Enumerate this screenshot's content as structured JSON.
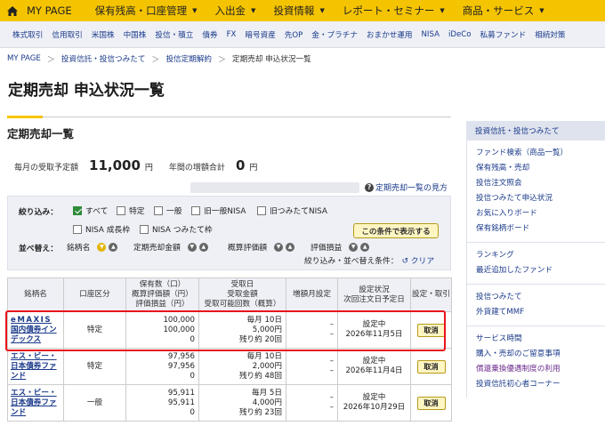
{
  "topnav": {
    "items": [
      {
        "label": "MY PAGE",
        "has_caret": false
      },
      {
        "label": "保有残高・口座管理",
        "has_caret": true
      },
      {
        "label": "入出金",
        "has_caret": true
      },
      {
        "label": "投資情報",
        "has_caret": true
      },
      {
        "label": "レポート・セミナー",
        "has_caret": true
      },
      {
        "label": "商品・サービス",
        "has_caret": true
      }
    ],
    "caret": "▼",
    "home_icon": "home-icon"
  },
  "subnav": {
    "links": [
      "株式取引",
      "信用取引",
      "米国株",
      "中国株",
      "投信・積立",
      "債券",
      "FX",
      "暗号資産",
      "先OP",
      "金・プラチナ",
      "おまかせ運用",
      "NISA",
      "iDeCo",
      "私募ファンド",
      "相続対策"
    ]
  },
  "breadcrumb": {
    "items": [
      "MY PAGE",
      "投資信託・投信つみたて",
      "投信定期解約"
    ],
    "current": "定期売却 申込状況一覧",
    "separator": "＞"
  },
  "page_title": "定期売却 申込状況一覧",
  "section_title": "定期売却一覧",
  "summary": {
    "monthly_label": "毎月の受取予定額",
    "monthly_value": "11,000",
    "monthly_unit": "円",
    "annual_label": "年間の増額合計",
    "annual_value": "0",
    "annual_unit": "円"
  },
  "guide_link": "定期売却一覧の見方",
  "filter": {
    "label": "絞り込み：",
    "options": [
      {
        "label": "すべて",
        "checked": true
      },
      {
        "label": "特定",
        "checked": false
      },
      {
        "label": "一般",
        "checked": false
      },
      {
        "label": "旧一般NISA",
        "checked": false
      },
      {
        "label": "旧つみたてNISA",
        "checked": false
      },
      {
        "label": "NISA 成長枠",
        "checked": false
      },
      {
        "label": "NISA つみたて枠",
        "checked": false
      }
    ],
    "apply_button": "この条件で表示する",
    "sort_label": "並べ替え：",
    "sort_fields": [
      {
        "label": "銘柄名",
        "up": "▲",
        "down": "▼",
        "active": "down"
      },
      {
        "label": "定期売却金額",
        "up": "▲",
        "down": "▼",
        "active": ""
      },
      {
        "label": "概算評価額",
        "up": "▲",
        "down": "▼",
        "active": ""
      },
      {
        "label": "評価損益",
        "up": "▲",
        "down": "▼",
        "active": ""
      }
    ],
    "clear_prefix": "絞り込み・並べ替え条件：",
    "clear_icon": "↺",
    "clear_label": "クリア"
  },
  "table": {
    "headers": {
      "name": "銘柄名",
      "account": "口座区分",
      "holdings": [
        "保有数（口）",
        "概算評価額（円）",
        "評価損益（円）"
      ],
      "receipt": [
        "受取日",
        "受取金額",
        "受取可能回数（概算）"
      ],
      "increase": "増額月設定",
      "status": [
        "設定状況",
        "次回注文日予定日"
      ],
      "action": "設定・取引"
    },
    "rows": [
      {
        "name": [
          "eMAXIS",
          "国内債券インデックス"
        ],
        "account": "特定",
        "holdings": [
          "100,000",
          "100,000",
          "0"
        ],
        "receipt": [
          "毎月 10日",
          "5,000円",
          "残り約 20回"
        ],
        "increase": [
          "–",
          "–"
        ],
        "status": [
          "設定中",
          "2026年11月5日"
        ],
        "action": "取消"
      },
      {
        "name": [
          "エス・ビー・",
          "日本債券ファ",
          "ンド"
        ],
        "account": "特定",
        "holdings": [
          "97,956",
          "97,956",
          "0"
        ],
        "receipt": [
          "毎月 10日",
          "2,000円",
          "残り約 48回"
        ],
        "increase": [
          "–",
          "–"
        ],
        "status": [
          "設定中",
          "2026年11月4日"
        ],
        "action": "取消"
      },
      {
        "name": [
          "エス・ビー・",
          "日本債券ファ",
          "ンド"
        ],
        "account": "一般",
        "holdings": [
          "95,911",
          "95,911",
          "0"
        ],
        "receipt": [
          "毎月 5日",
          "4,000円",
          "残り約 23回"
        ],
        "increase": [
          "–",
          "–"
        ],
        "status": [
          "設定中",
          "2026年10月29日"
        ],
        "action": "取消"
      }
    ]
  },
  "sidebar": {
    "header": "投資信託・投信つみたて",
    "groups": [
      [
        "ファンド検索（商品一覧）",
        "保有残高・売却",
        "投信注文照会",
        "投信つみたて申込状況",
        "お気に入りボード",
        "保有銘柄ボード"
      ],
      [
        "ランキング",
        "最近追加したファンド"
      ],
      [
        "投信つみたて",
        "外貨建てMMF"
      ],
      [
        "サービス時間",
        "購入・売却のご留意事項",
        "償還乗換優遇制度の利用",
        "投資信託初心者コーナー"
      ]
    ]
  },
  "colors": {
    "brand_yellow": "#f5c400",
    "link_blue": "#1a3a8a",
    "highlight_red": "#e8131b",
    "check_green": "#2e8b3a"
  }
}
